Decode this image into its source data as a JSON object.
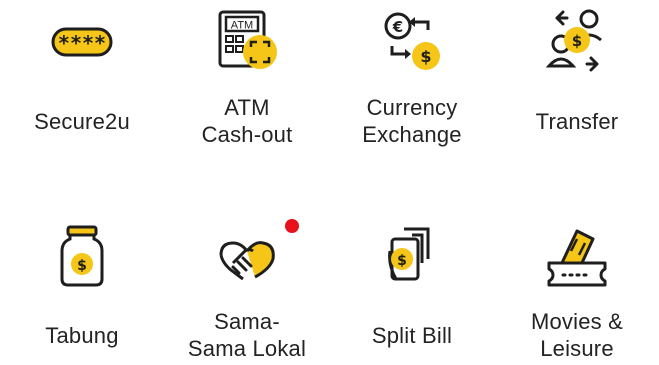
{
  "colors": {
    "accent": "#F5C518",
    "stroke": "#1e1e1e",
    "notification": "#E8101A"
  },
  "menu": {
    "items": [
      {
        "label_lines": [
          "Secure2u"
        ],
        "icon": "password-card-icon"
      },
      {
        "label_lines": [
          "ATM",
          "Cash-out"
        ],
        "icon": "atm-icon"
      },
      {
        "label_lines": [
          "Currency",
          "Exchange"
        ],
        "icon": "currency-exchange-icon"
      },
      {
        "label_lines": [
          "Transfer"
        ],
        "icon": "transfer-icon"
      },
      {
        "label_lines": [
          "Tabung"
        ],
        "icon": "savings-jar-icon"
      },
      {
        "label_lines": [
          "Sama-",
          "Sama Lokal"
        ],
        "icon": "handshake-icon",
        "has_notification": true
      },
      {
        "label_lines": [
          "Split Bill"
        ],
        "icon": "split-bill-icon"
      },
      {
        "label_lines": [
          "Movies &",
          "Leisure"
        ],
        "icon": "movie-ticket-icon"
      }
    ]
  },
  "icon_text": {
    "secure_mask": "****",
    "atm_screen": "ATM",
    "euro": "€",
    "dollar": "$"
  }
}
